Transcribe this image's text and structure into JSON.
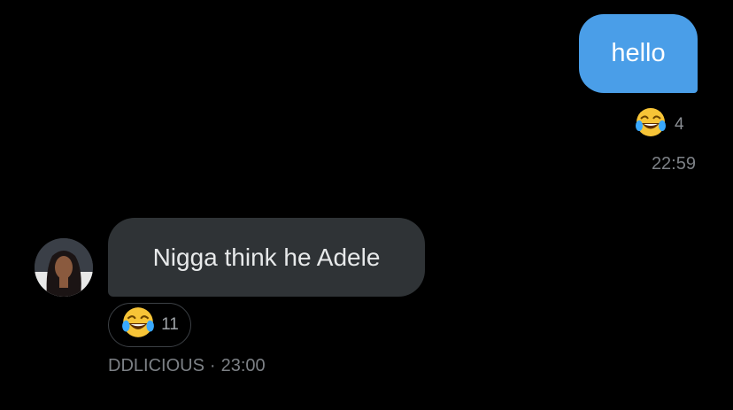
{
  "messages": [
    {
      "direction": "outgoing",
      "text": "hello",
      "reaction": {
        "emoji": "😂",
        "count": "4"
      },
      "time": "22:59"
    },
    {
      "direction": "incoming",
      "text": "Nigga think he Adele",
      "reaction": {
        "emoji": "😂",
        "count": "11"
      },
      "sender": "DDLICIOUS",
      "time_sep": "·",
      "time": "23:00"
    }
  ],
  "colors": {
    "outgoing_bubble": "#4a9ee8",
    "incoming_bubble": "#2f3336",
    "background": "#000000"
  },
  "icons": {
    "reaction": "laughing-tears-emoji",
    "avatar": "user-avatar"
  }
}
